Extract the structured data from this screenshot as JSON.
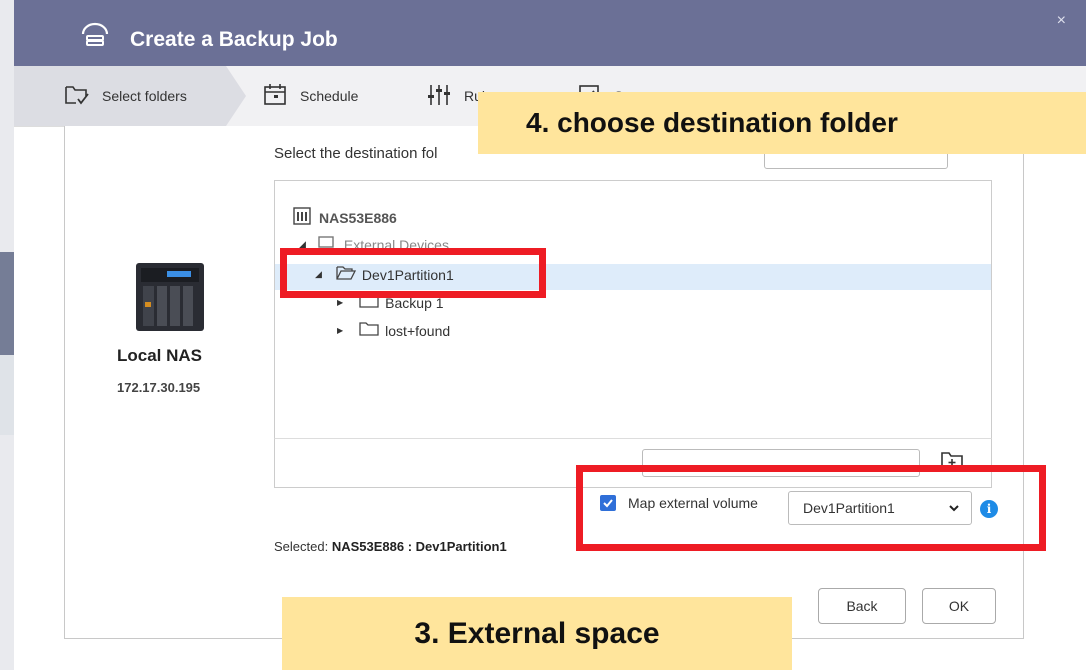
{
  "dialog": {
    "title": "Create a Backup Job",
    "close_symbol": "×"
  },
  "steps": [
    {
      "label": "Select folders",
      "icon": "folder-check-icon"
    },
    {
      "label": "Schedule",
      "icon": "calendar-icon"
    },
    {
      "label": "Rules",
      "icon": "sliders-icon"
    },
    {
      "label": "Summary",
      "icon": "clipboard-check-icon"
    }
  ],
  "source": {
    "name": "Local NAS",
    "ip": "172.17.30.195"
  },
  "destination_label": "Select the destination fol",
  "tree": {
    "root": "NAS53E886",
    "external": "External Devices",
    "partition": "Dev1Partition1",
    "backup": "Backup 1",
    "lost_found": "lost+found"
  },
  "map_external": {
    "label": "Map external volume",
    "selected": "Dev1Partition1",
    "checked": true
  },
  "selected": {
    "prefix": "Selected:",
    "value": "NAS53E886 : Dev1Partition1"
  },
  "buttons": {
    "back": "Back",
    "ok": "OK"
  },
  "annotations": {
    "callout_top": "4. choose destination folder",
    "callout_bottom": "3. External space"
  },
  "colors": {
    "header": "#6b7096",
    "highlight": "#ee1c24",
    "callout": "#ffe59c",
    "accent": "#2f6fd8"
  }
}
